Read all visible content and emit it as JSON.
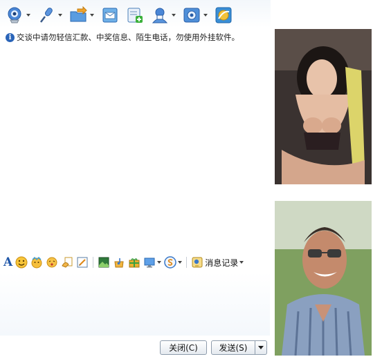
{
  "toolbar": {
    "items": [
      {
        "icon": "webcam-icon",
        "has_menu": true
      },
      {
        "icon": "microphone-icon",
        "has_menu": true
      },
      {
        "icon": "folder-transfer-icon",
        "has_menu": true
      },
      {
        "icon": "mail-icon",
        "has_menu": false
      },
      {
        "icon": "add-note-icon",
        "has_menu": false
      },
      {
        "icon": "user-card-icon",
        "has_menu": true
      },
      {
        "icon": "settings-icon",
        "has_menu": true
      },
      {
        "icon": "app-globe-icon",
        "has_menu": false
      }
    ]
  },
  "chat": {
    "notice": "交谈中请勿轻信汇款、中奖信息、陌生电话，勿使用外挂软件。"
  },
  "format_bar": {
    "font_glyph": "A",
    "history_label": "消息记录"
  },
  "buttons": {
    "close_label": "关闭(C)",
    "send_label": "发送(S)"
  },
  "colors": {
    "accent": "#1f56a8",
    "button_border": "#8d9bab"
  }
}
